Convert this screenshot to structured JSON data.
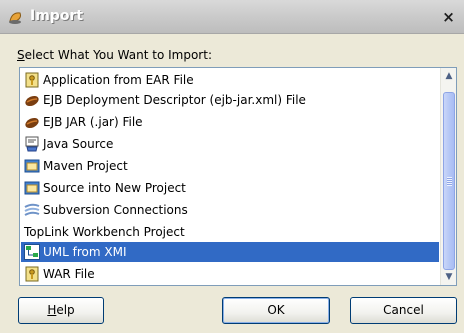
{
  "window": {
    "title": "Import",
    "close_label": "×"
  },
  "prompt": {
    "accel": "S",
    "rest": "elect What You Want to Import:"
  },
  "list": {
    "items": [
      {
        "label": "Application from EAR File",
        "icon": "ear-file-icon"
      },
      {
        "label": "EJB Deployment Descriptor (ejb-jar.xml) File",
        "icon": "bean-icon"
      },
      {
        "label": "EJB JAR (.jar) File",
        "icon": "bean-icon"
      },
      {
        "label": "Java Source",
        "icon": "java-source-icon"
      },
      {
        "label": "Maven Project",
        "icon": "folder-icon"
      },
      {
        "label": "Source into New Project",
        "icon": "folder-icon"
      },
      {
        "label": "Subversion Connections",
        "icon": "subversion-icon"
      },
      {
        "label": "TopLink Workbench Project",
        "icon": ""
      },
      {
        "label": "UML from XMI",
        "icon": "uml-icon",
        "selected": true
      },
      {
        "label": "WAR File",
        "icon": "war-file-icon"
      }
    ]
  },
  "buttons": {
    "help_accel": "H",
    "help_rest": "elp",
    "ok": "OK",
    "cancel": "Cancel"
  },
  "colors": {
    "selection": "#316ac5",
    "title_bar": "#c9c9c9",
    "dialog_bg": "#ece9d8"
  }
}
